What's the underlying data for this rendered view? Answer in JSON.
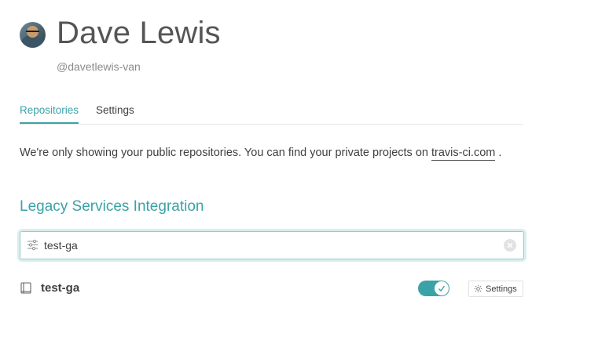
{
  "profile": {
    "name": "Dave Lewis",
    "handle": "@davetlewis-van"
  },
  "tabs": [
    {
      "label": "Repositories",
      "active": true
    },
    {
      "label": "Settings",
      "active": false
    }
  ],
  "notice": {
    "text": "We're only showing your public repositories. You can find your private projects on ",
    "link_text": "travis-ci.com",
    "suffix": " ."
  },
  "section": {
    "title": "Legacy Services Integration"
  },
  "search": {
    "value": "test-ga",
    "filter_icon": "filter-sliders-icon",
    "clear_icon": "clear-icon"
  },
  "repositories": [
    {
      "name": "test-ga",
      "icon": "repo-book-icon",
      "enabled": true,
      "settings_label": "Settings"
    }
  ],
  "colors": {
    "accent": "#3ba3a7",
    "text": "#404040",
    "muted": "#8a8a8a"
  }
}
